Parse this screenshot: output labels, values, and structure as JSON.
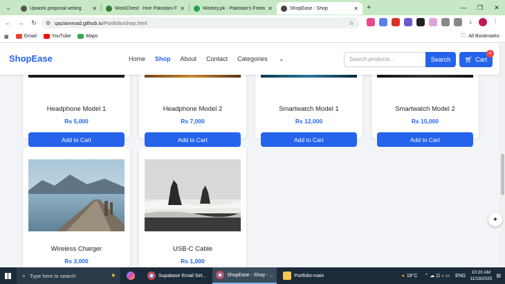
{
  "browser": {
    "tabs": [
      {
        "title": "Upwork proposal writing",
        "fav_color": "#555555",
        "active": false
      },
      {
        "title": "WorkChest - Hire Pakistani Free",
        "fav_color": "#2e7d32",
        "active": false
      },
      {
        "title": "Workey.pk - Pakistan's Freelan",
        "fav_color": "#22a34a",
        "active": false
      },
      {
        "title": "ShopEase - Shop",
        "fav_color": "#444444",
        "active": true
      }
    ],
    "url_host": "qaziammad.github.io",
    "url_path": "/Portfolio/shop.html",
    "bookmarks": [
      {
        "label": "Gmail",
        "color": "#ea4335"
      },
      {
        "label": "YouTube",
        "color": "#ff0000"
      },
      {
        "label": "Maps",
        "color": "#34a853"
      }
    ],
    "all_bookmarks": "All Bookmarks"
  },
  "site": {
    "brand": "ShopEase",
    "nav": [
      "Home",
      "Shop",
      "About",
      "Contact",
      "Categories"
    ],
    "active_nav": "Shop",
    "search_placeholder": "Search products...",
    "search_button": "Search",
    "cart_label": "Cart",
    "cart_count": "0",
    "accent": "#2563eb"
  },
  "products_row1": [
    {
      "name": "Headphone Model 1",
      "price": "Rs 5,000",
      "button": "Add to Cart"
    },
    {
      "name": "Headphone Model 2",
      "price": "Rs 7,000",
      "button": "Add to Cart"
    },
    {
      "name": "Smartwatch Model 1",
      "price": "Rs 12,000",
      "button": "Add to Cart"
    },
    {
      "name": "Smartwatch Model 2",
      "price": "Rs 15,000",
      "button": "Add to Cart"
    }
  ],
  "products_row2": [
    {
      "name": "Wireless Charger",
      "price": "Rs 3,000"
    },
    {
      "name": "USB-C Cable",
      "price": "Rs 1,000"
    }
  ],
  "taskbar": {
    "search_placeholder": "Type here to search",
    "apps": [
      {
        "label": "Supabase Email Set...",
        "active": false
      },
      {
        "label": "ShopEase - Shop - ...",
        "active": true
      },
      {
        "label": "Portfolio-main",
        "active": false
      }
    ],
    "temperature": "18°C",
    "language": "ENG",
    "time": "10:20 AM",
    "date": "11/18/2025"
  }
}
